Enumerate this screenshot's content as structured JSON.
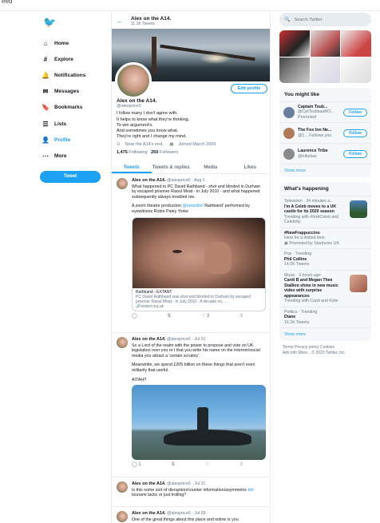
{
  "window": {
    "top_fragment": "eed"
  },
  "nav": {
    "items": [
      {
        "icon": "home-icon",
        "label": "Home"
      },
      {
        "icon": "explore-icon",
        "label": "Explore"
      },
      {
        "icon": "bell-icon",
        "label": "Notifications"
      },
      {
        "icon": "mail-icon",
        "label": "Messages"
      },
      {
        "icon": "bookmark-icon",
        "label": "Bookmarks"
      },
      {
        "icon": "list-icon",
        "label": "Lists"
      },
      {
        "icon": "person-icon",
        "label": "Profile"
      },
      {
        "icon": "more-icon",
        "label": "More"
      }
    ],
    "tweet_button": "Tweet"
  },
  "header": {
    "name": "Alex on the A14.",
    "tweet_count": "11.1K Tweets"
  },
  "profile": {
    "edit_button": "Edit profile",
    "name": "Alex on the A14.",
    "handle": "@alexprice0",
    "bio": [
      "I follow many I don't agree with.",
      "It helps to know what they're thinking.",
      "To win argument's.",
      "And sometimes you know what.",
      "They're right and I change my mind."
    ],
    "location": "Near the A14's end.",
    "joined": "Joined March 2009",
    "following_count": "1,475",
    "following_label": "Following",
    "followers_count": "250",
    "followers_label": "Followers"
  },
  "tabs": [
    "Tweets",
    "Tweets & replies",
    "Media",
    "Likes"
  ],
  "tweets": [
    {
      "name": "Alex on the A14.",
      "meta": "@alexprice0 · Aug 1",
      "text1": "What happened to PC David Rathband - shot and blinded in Durham by escaped prisoner Raoul Moat - in July 2010 - and what happened subsequently always troubled me.",
      "text2a": "A zoom theatre production ",
      "text2link": "@extantltd",
      "text2b": " 'Rathband' performed by eyewitness Robin Paley Yorke",
      "card_title": "Rathband - EXTANT",
      "card_desc": "PC David Rathband was shot and blinded in Durham by escaped prisoner Raoul Moat - in July 2010 - A decade on, ...",
      "card_url": "extant.org.uk",
      "likes": "3"
    },
    {
      "name": "Alex on the A14.",
      "meta": "@alexprice0 · Jul 31",
      "text1": "So a Lord of the realm with the power to propose and vote on UK legislation over you or I that you write his name on the internet/social media you attract a 'certain scrutiny'.",
      "text2": "Meanwhile, we spend £205 billion on these things that aren't even militarily that useful.",
      "text3": "AITAH?",
      "replies": "1"
    },
    {
      "name": "Alex on the A14.",
      "meta": "@alexprice0 · Jul 31",
      "text1a": "Is this some sort of disruption/counter information/asymmetric ",
      "text1link": "tirit",
      "text1b": " tsunami tactic or just trolling?"
    },
    {
      "name": "Alex on the A14.",
      "meta": "@alexprice0 · Jul 28",
      "text1": "One of the great things about this place and online is you"
    }
  ],
  "search": {
    "placeholder": "Search Twitter"
  },
  "who_to_follow": {
    "title": "You might like",
    "items": [
      {
        "name": "Captain Tsub...",
        "handle": "@CptTsubasaRO...",
        "sub": "Promoted",
        "button": "Follow"
      },
      {
        "name": "The Fox Inn Ne...",
        "handle": "@1...",
        "sub": "Follows you",
        "button": "Follow"
      },
      {
        "name": "Laurence Tribe",
        "handle": "@tribelaw",
        "sub": "",
        "button": "Follow"
      }
    ],
    "show_more": "Show more"
  },
  "happening": {
    "title": "What's happening",
    "items": [
      {
        "ctx": "Television · 34 minutes a...",
        "title": "I'm A Celeb moves to a UK castle for its 2020 season",
        "sub": "Trending with #ImACeleb and Celebrity"
      },
      {
        "ctx": "",
        "title": "#NewFrappuccino",
        "sub": "Here for a limited time",
        "sub2": "Promoted by Starbucks UK"
      },
      {
        "ctx": "Pop · Trending",
        "title": "Phil Collins",
        "sub": "14.5K Tweets"
      },
      {
        "ctx": "Music · 3 hours ago",
        "title": "Cardi B and Megan Thee Stallion shine in new music video with surprise appearances",
        "sub": "Trending with Cardi and Kylie"
      },
      {
        "ctx": "Politics · Trending",
        "title": "Diane",
        "sub": "16.1K Tweets"
      }
    ],
    "show_more": "Show more"
  },
  "footer": {
    "line1": "Terms  Privacy policy  Cookies",
    "line2": "Ads info  More...  © 2020 Twitter, Inc."
  },
  "colors": {
    "accent": "#1da1f2",
    "secondary_text": "#657786",
    "border": "#e6ecf0"
  }
}
